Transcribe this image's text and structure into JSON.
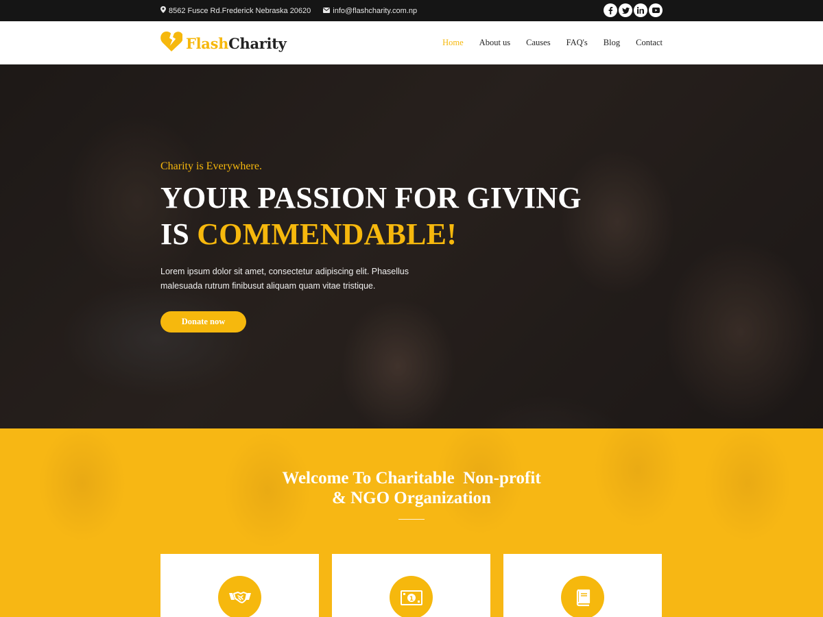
{
  "topbar": {
    "address": "8562 Fusce Rd.Frederick Nebraska 20620",
    "email": "info@flashcharity.com.np",
    "social": [
      {
        "name": "facebook-icon",
        "glyph": "f"
      },
      {
        "name": "twitter-icon",
        "glyph": "t"
      },
      {
        "name": "linkedin-icon",
        "glyph": "in"
      },
      {
        "name": "youtube-icon",
        "glyph": "yt"
      }
    ]
  },
  "brand": {
    "name_part1": "Flash",
    "name_part2": "Charity",
    "accent_color": "#f6b80d",
    "dark_color": "#151515"
  },
  "nav": {
    "items": [
      {
        "label": "Home",
        "active": true
      },
      {
        "label": "About us",
        "active": false
      },
      {
        "label": "Causes",
        "active": false
      },
      {
        "label": "FAQ's",
        "active": false
      },
      {
        "label": "Blog",
        "active": false
      },
      {
        "label": "Contact",
        "active": false
      }
    ]
  },
  "hero": {
    "tagline": "Charity is Everywhere.",
    "headline_line1": "YOUR PASSION FOR GIVING",
    "headline_line2_prefix": "IS ",
    "headline_line2_highlight": "COMMENDABLE",
    "headline_line2_suffix": "!",
    "text": "Lorem ipsum dolor sit amet, consectetur adipiscing elit. Phasellus malesuada rutrum finibusut aliquam quam vitae tristique.",
    "button_label": "Donate now"
  },
  "welcome": {
    "title_line1": "Welcome To Charitable  Non-profit",
    "title_line2": "& NGO Organization",
    "cards": [
      {
        "icon": "handshake-icon"
      },
      {
        "icon": "money-bill-icon"
      },
      {
        "icon": "book-icon"
      }
    ]
  }
}
